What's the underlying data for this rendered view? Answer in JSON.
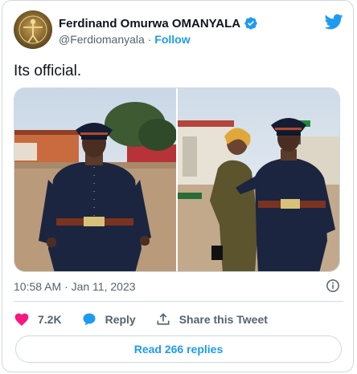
{
  "author": {
    "display_name": "Ferdinand Omurwa OMANYALA",
    "handle": "@Ferdiomanyala",
    "separator": "·",
    "follow_label": "Follow"
  },
  "tweet": {
    "text": "Its official.",
    "timestamp": "10:58 AM · Jan 11, 2023"
  },
  "actions": {
    "like_count": "7.2K",
    "reply_label": "Reply",
    "share_label": "Share this Tweet"
  },
  "replies_button": "Read 266 replies",
  "colors": {
    "accent": "#1d9bf0",
    "like": "#f91880",
    "text_secondary": "#536471",
    "border": "#cfd9de"
  },
  "icons": [
    "verified-badge-icon",
    "twitter-bird-icon",
    "info-icon",
    "heart-icon",
    "reply-bubble-icon",
    "share-icon"
  ]
}
